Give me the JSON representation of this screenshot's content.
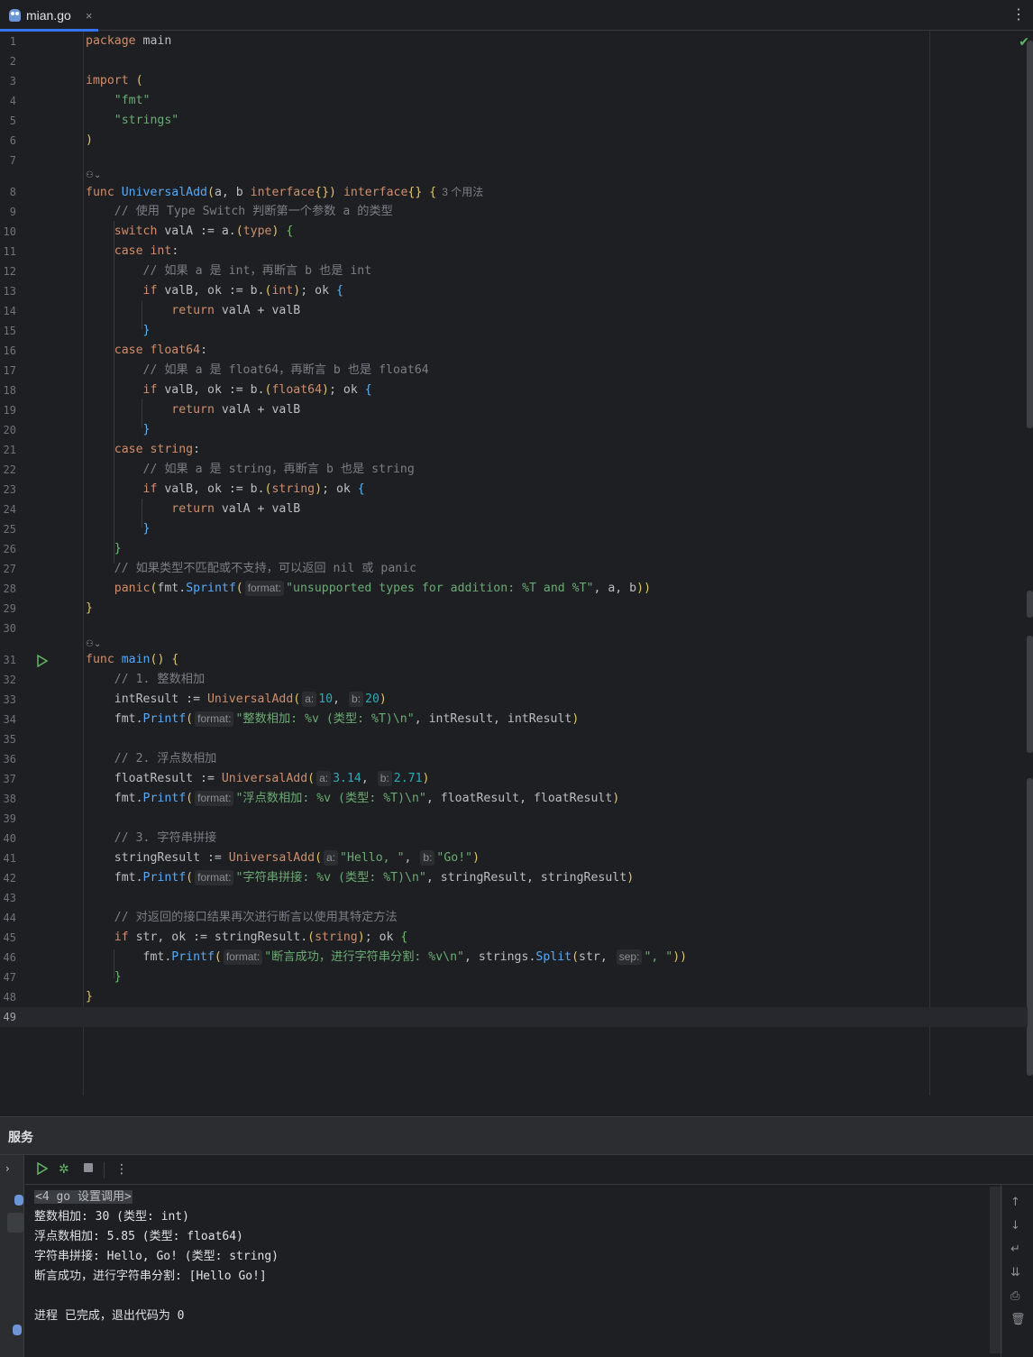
{
  "tab": {
    "filename": "mian.go",
    "close": "×",
    "more": "⋮"
  },
  "editor": {
    "usages": "3 个用法",
    "hints": {
      "format": "format:",
      "a": "a:",
      "b": "b:",
      "sep": "sep:"
    }
  },
  "code_lines": [
    "package main",
    "",
    "import (",
    "    \"fmt\"",
    "    \"strings\"",
    ")",
    "",
    "func UniversalAdd(a, b interface{}) interface{} {",
    "    // 使用 Type Switch 判断第一个参数 a 的类型",
    "    switch valA := a.(type) {",
    "    case int:",
    "        // 如果 a 是 int，再断言 b 也是 int",
    "        if valB, ok := b.(int); ok {",
    "            return valA + valB",
    "        }",
    "    case float64:",
    "        // 如果 a 是 float64，再断言 b 也是 float64",
    "        if valB, ok := b.(float64); ok {",
    "            return valA + valB",
    "        }",
    "    case string:",
    "        // 如果 a 是 string，再断言 b 也是 string",
    "        if valB, ok := b.(string); ok {",
    "            return valA + valB",
    "        }",
    "    }",
    "    // 如果类型不匹配或不支持，可以返回 nil 或 panic",
    "    panic(fmt.Sprintf(\"unsupported types for addition: %T and %T\", a, b))",
    "}",
    "",
    "func main() {",
    "    // 1. 整数相加",
    "    intResult := UniversalAdd(10, 20)",
    "    fmt.Printf(\"整数相加: %v (类型: %T)\\n\", intResult, intResult)",
    "",
    "    // 2. 浮点数相加",
    "    floatResult := UniversalAdd(3.14, 2.71)",
    "    fmt.Printf(\"浮点数相加: %v (类型: %T)\\n\", floatResult, floatResult)",
    "",
    "    // 3. 字符串拼接",
    "    stringResult := UniversalAdd(\"Hello, \", \"Go!\")",
    "    fmt.Printf(\"字符串拼接: %v (类型: %T)\\n\", stringResult, stringResult)",
    "",
    "    // 对返回的接口结果再次进行断言以使用其特定方法",
    "    if str, ok := stringResult.(string); ok {",
    "        fmt.Printf(\"断言成功，进行字符串分割: %v\\n\", strings.Split(str, \", \"))",
    "    }",
    "}",
    ""
  ],
  "services": {
    "title": "服务",
    "console": [
      "<4 go 设置调用>",
      "整数相加: 30 (类型: int)",
      "浮点数相加: 5.85 (类型: float64)",
      "字符串拼接: Hello, Go! (类型: string)",
      "断言成功，进行字符串分割: [Hello Go!]",
      "",
      "进程 已完成，退出代码为 0"
    ]
  },
  "colors": {
    "background": "#1e1f22",
    "keyword": "#cf8e6d",
    "function": "#56a8f5",
    "string": "#6aab73",
    "number": "#2aacb8",
    "comment": "#7a7e85",
    "accent": "#3574f0"
  },
  "icons": [
    "gopher-file-icon",
    "close-icon",
    "more-icon",
    "check-icon",
    "run-gutter-icon",
    "run-icon",
    "debug-icon",
    "stop-icon",
    "scroll-up-icon",
    "scroll-down-icon",
    "soft-wrap-icon",
    "scroll-to-end-icon",
    "print-icon",
    "trash-icon"
  ]
}
